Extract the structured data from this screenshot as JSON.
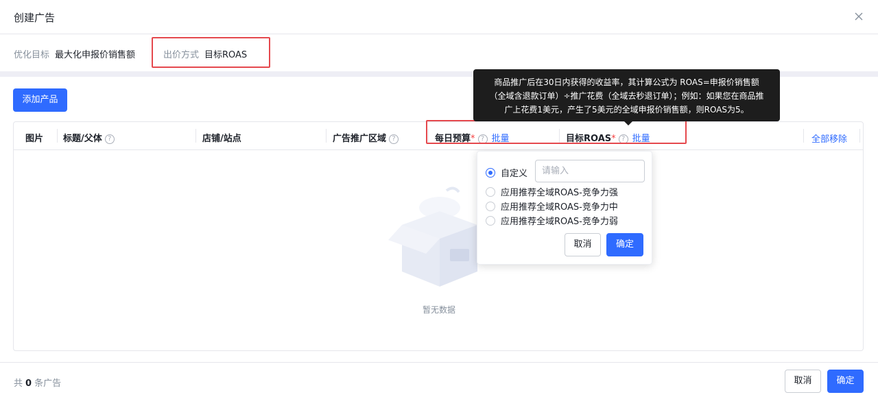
{
  "header": {
    "title": "创建广告"
  },
  "info": {
    "optimize_label": "优化目标",
    "optimize_value": "最大化申报价销售额",
    "bid_label": "出价方式",
    "bid_value": "目标ROAS"
  },
  "toolbar": {
    "add_product": "添加产品"
  },
  "table": {
    "columns": {
      "image": "图片",
      "title": "标题/父体",
      "store": "店铺/站点",
      "region": "广告推广区域",
      "budget": "每日预算",
      "roas": "目标ROAS"
    },
    "required_mark": "*",
    "help_glyph": "?",
    "batch_label": "批量",
    "remove_all": "全部移除",
    "empty_text": "暂无数据"
  },
  "tooltip": {
    "lines": [
      "商品推广后在30日内获得的收益率，其计算公式为 ROAS=申报价销售额",
      "（全域含退款订单）÷推广花费（全域去秒退订单）；例如：如果您在商品推",
      "广上花费1美元，产生了5美元的全域申报价销售额，则ROAS为5。"
    ]
  },
  "popover": {
    "options": [
      {
        "label": "自定义",
        "selected": true
      },
      {
        "label": "应用推荐全域ROAS-竞争力强",
        "selected": false
      },
      {
        "label": "应用推荐全域ROAS-竞争力中",
        "selected": false
      },
      {
        "label": "应用推荐全域ROAS-竞争力弱",
        "selected": false
      }
    ],
    "input_placeholder": "请输入",
    "cancel": "取消",
    "confirm": "确定"
  },
  "footer": {
    "count_prefix": "共",
    "count_value": "0",
    "count_suffix": "条广告",
    "cancel": "取消",
    "confirm": "确定"
  },
  "colors": {
    "primary": "#2f6bff",
    "highlight_box": "#e5484d",
    "required": "#f53f3f"
  }
}
